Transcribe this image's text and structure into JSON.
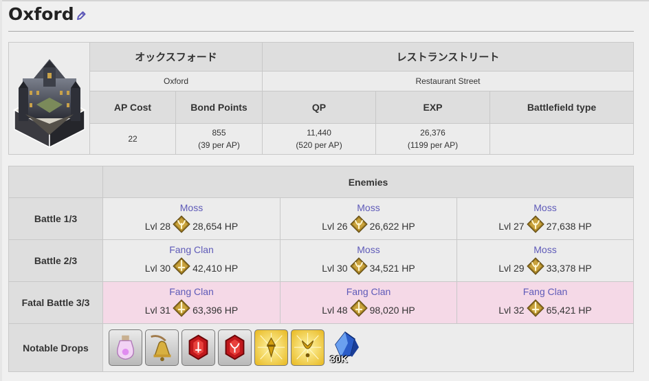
{
  "page": {
    "title": "Oxford",
    "edit_icon": "pencil-icon",
    "accent_color": "#5e5ab8"
  },
  "info": {
    "jp_name": "オックスフォード",
    "en_name": "Oxford",
    "jp_node": "レストランストリート",
    "en_node": "Restaurant Street",
    "headers": {
      "ap": "AP Cost",
      "bond": "Bond Points",
      "qp": "QP",
      "exp": "EXP",
      "field": "Battlefield type"
    },
    "values": {
      "ap": "22",
      "bond": "855",
      "bond_per": "(39 per AP)",
      "qp": "11,440",
      "qp_per": "(520 per AP)",
      "exp": "26,376",
      "exp_per": "(1199 per AP)",
      "field": ""
    }
  },
  "battle": {
    "enemies_header": "Enemies",
    "rows": [
      {
        "label": "Battle 1/3",
        "enemies": [
          {
            "name": "Moss",
            "lvl": "Lvl 28",
            "hp": "28,654 HP",
            "class_icon": "assassin-class-icon"
          },
          {
            "name": "Moss",
            "lvl": "Lvl 26",
            "hp": "26,622 HP",
            "class_icon": "assassin-class-icon"
          },
          {
            "name": "Moss",
            "lvl": "Lvl 27",
            "hp": "27,638 HP",
            "class_icon": "assassin-class-icon"
          }
        ]
      },
      {
        "label": "Battle 2/3",
        "enemies": [
          {
            "name": "Fang Clan",
            "lvl": "Lvl 30",
            "hp": "42,410 HP",
            "class_icon": "saber-class-icon"
          },
          {
            "name": "Moss",
            "lvl": "Lvl 30",
            "hp": "34,521 HP",
            "class_icon": "assassin-class-icon"
          },
          {
            "name": "Moss",
            "lvl": "Lvl 29",
            "hp": "33,378 HP",
            "class_icon": "assassin-class-icon"
          }
        ]
      },
      {
        "label": "Fatal Battle 3/3",
        "enemies": [
          {
            "name": "Fang Clan",
            "lvl": "Lvl 31",
            "hp": "63,396 HP",
            "class_icon": "saber-class-icon"
          },
          {
            "name": "Fang Clan",
            "lvl": "Lvl 48",
            "hp": "98,020 HP",
            "class_icon": "saber-class-icon"
          },
          {
            "name": "Fang Clan",
            "lvl": "Lvl 32",
            "hp": "65,421 HP",
            "class_icon": "saber-class-icon"
          }
        ]
      }
    ],
    "drops_label": "Notable Drops",
    "drops": [
      {
        "icon": "potion-bottle-icon"
      },
      {
        "icon": "bell-icon"
      },
      {
        "icon": "red-saber-gem-icon"
      },
      {
        "icon": "red-assassin-gem-icon"
      },
      {
        "icon": "gold-saber-piece-icon"
      },
      {
        "icon": "gold-assassin-piece-icon"
      }
    ],
    "qp_drop": {
      "icon": "qp-crystal-icon",
      "amount": "30K"
    }
  }
}
